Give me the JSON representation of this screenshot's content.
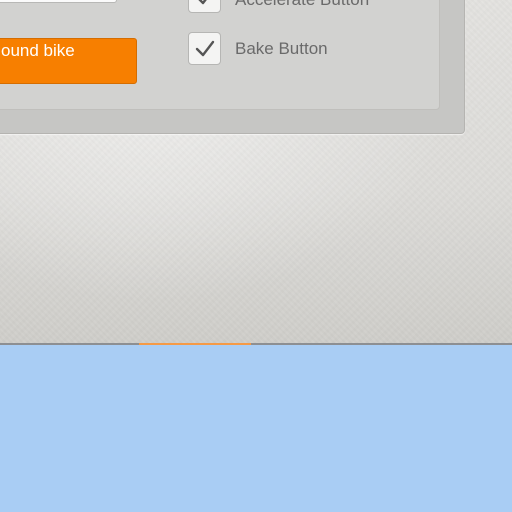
{
  "panel": {
    "text_field_value": "",
    "orange_button_label": "ound bike",
    "checkboxes": [
      {
        "label": "Accelerate Button",
        "checked": true
      },
      {
        "label": "Bake Button",
        "checked": true
      }
    ]
  },
  "colors": {
    "accent_orange": "#f77f00",
    "lower_area_blue": "#a9cdf4",
    "tab_indicator": "#f59a46"
  }
}
